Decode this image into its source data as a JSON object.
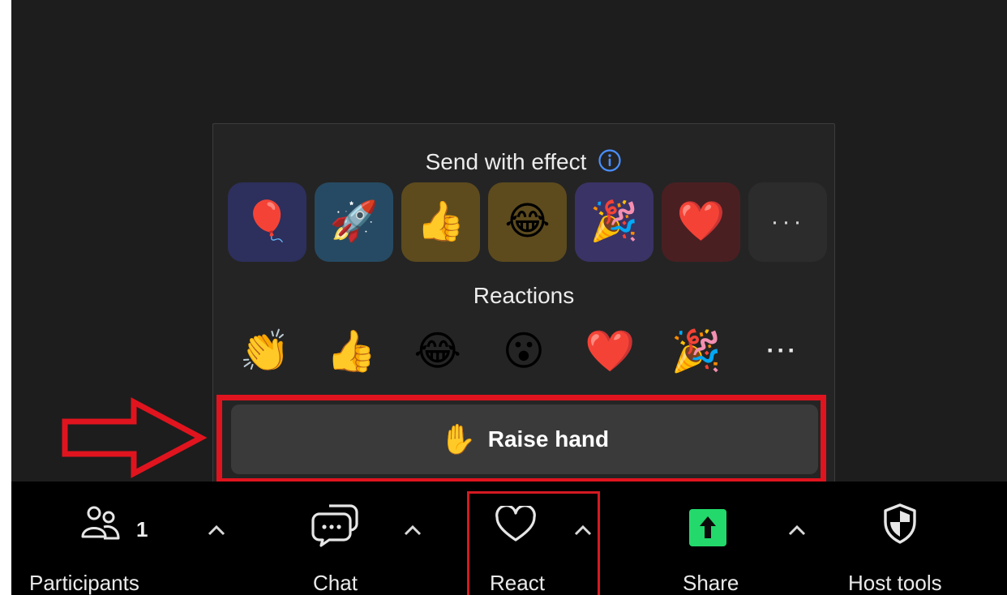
{
  "popup": {
    "effect_title": "Send with effect",
    "effects": [
      {
        "icon": "balloon-icon",
        "glyph": "🎈",
        "bg": "#2d2f5c"
      },
      {
        "icon": "rocket-icon",
        "glyph": "🚀",
        "bg": "#264a63"
      },
      {
        "icon": "thumbs-up-icon",
        "glyph": "👍",
        "bg": "#5d4b1e"
      },
      {
        "icon": "laughing-icon",
        "glyph": "😂",
        "bg": "#5d4b1e"
      },
      {
        "icon": "party-popper-icon",
        "glyph": "🎉",
        "bg": "#3a3366"
      },
      {
        "icon": "heart-icon",
        "glyph": "❤️",
        "bg": "#4a1f22"
      }
    ],
    "effects_more": "···",
    "reactions_title": "Reactions",
    "reactions": [
      {
        "icon": "clapping-hands-icon",
        "glyph": "👏"
      },
      {
        "icon": "thumbs-up-icon",
        "glyph": "👍"
      },
      {
        "icon": "laughing-icon",
        "glyph": "😂"
      },
      {
        "icon": "surprised-face-icon",
        "glyph": "😮"
      },
      {
        "icon": "heart-icon",
        "glyph": "❤️"
      },
      {
        "icon": "party-popper-icon",
        "glyph": "🎉"
      }
    ],
    "reactions_more": "···",
    "raise_hand_glyph": "✋",
    "raise_hand_label": "Raise hand"
  },
  "toolbar": {
    "participants_label": "Participants",
    "participants_count": "1",
    "chat_label": "Chat",
    "react_label": "React",
    "share_label": "Share",
    "host_tools_label": "Host tools",
    "share_color": "#23d96b"
  },
  "colors": {
    "annotation_red": "#e0141e",
    "background": "#1d1d1d"
  }
}
